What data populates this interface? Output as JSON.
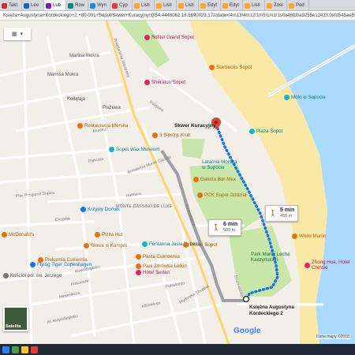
{
  "browser": {
    "tabs": [
      {
        "label": "Takt",
        "color": "#d32f2f"
      },
      {
        "label": "Leo",
        "color": "#1565c0"
      },
      {
        "label": "Lub",
        "color": "#7b1fa2"
      },
      {
        "label": "Row",
        "color": "#00897b"
      },
      {
        "label": "Wyn",
        "color": "#1e88e5"
      },
      {
        "label": "Cyp",
        "color": "#e53935"
      },
      {
        "label": "Listi",
        "color": "#f9a825"
      },
      {
        "label": "Listi",
        "color": "#f9a825"
      },
      {
        "label": "Listi",
        "color": "#f9a825"
      },
      {
        "label": "Edyt",
        "color": "#f9a825"
      },
      {
        "label": "Edyt",
        "color": "#f9a825"
      },
      {
        "label": "Listi",
        "color": "#f9a825"
      },
      {
        "label": "Zosi",
        "color": "#f9a825"
      },
      {
        "label": "Pod",
        "color": "#f9a825"
      }
    ],
    "active_tab": 2,
    "url": "Księża+Augustyna+Kordeckiego+2,+80-001+Sopot/Skwer+Kuracyjny/@54.4446062,18.5690029,17z/data=!4m13!4m12!1m5!1m1!1s0x46fd0a9255e12433:0xfd545ae55c5d"
  },
  "map": {
    "colors": {
      "water": "#aadaff",
      "beach": "#fae9a6",
      "park": "#c8e6a7",
      "route_dots": "#1a73e8",
      "route_gray": "#9aa0a6",
      "restaurant": "#e8710a",
      "attraction": "#12b5cb",
      "shopping": "#1a73e8",
      "hotel": "#e91e63",
      "poi_green": "#0f9d58"
    },
    "layer_button_icon": "map-layers-icon",
    "destination": {
      "label": "Skwer Kuracyjny"
    },
    "origin": {
      "label_line1": "Księżna Augustyna",
      "label_line2": "Kordeckiego 2"
    },
    "walk_box_1": {
      "time": "5 min",
      "distance": "450 m",
      "icon": "walking-person-icon"
    },
    "walk_box_2": {
      "time": "6 min",
      "distance": "500 m",
      "icon": "walking-person-icon"
    },
    "places": [
      {
        "text": "Sofitel Grand Sopot",
        "kind": "hotel"
      },
      {
        "text": "Sheraton Sopot",
        "kind": "hotel"
      },
      {
        "text": "Starbucks Sopot",
        "kind": "restaurant"
      },
      {
        "text": "Molo w Sopocie",
        "kind": "attraction"
      },
      {
        "text": "Restauracja Morska",
        "kind": "restaurant"
      },
      {
        "text": "3 Siostry. Klub",
        "kind": "restaurant"
      },
      {
        "text": "Plaża Sopot",
        "kind": "attraction"
      },
      {
        "text": "Sopot Wax Museum",
        "kind": "attraction"
      },
      {
        "text": "Latarnia Morska w Sopocie",
        "kind": "attraction"
      },
      {
        "text": "Krzywy Domek",
        "kind": "shopping"
      },
      {
        "text": "Galeria Bar-Mex",
        "kind": "restaurant"
      },
      {
        "text": "PCK Sopot Oddział",
        "kind": "restaurant"
      },
      {
        "text": "Pizza Hut",
        "kind": "restaurant"
      },
      {
        "text": "Piekarnia Cukiernia",
        "kind": "restaurant"
      },
      {
        "text": "Fontanna Jasia Rybaka",
        "kind": "attraction"
      },
      {
        "text": "Polski Sopot",
        "kind": "restaurant"
      },
      {
        "text": "Pasta Cukrownia",
        "kind": "restaurant"
      },
      {
        "text": "Pani Zdrówka Łelkin",
        "kind": "restaurant"
      },
      {
        "text": "Słowa w Kompot",
        "kind": "restaurant"
      },
      {
        "text": "Hotel Sedan",
        "kind": "hotel"
      },
      {
        "text": "Flying Tiger Copenhagen",
        "kind": "shopping"
      },
      {
        "text": "McDonald's",
        "kind": "restaurant"
      },
      {
        "text": "White Marlin",
        "kind": "restaurant"
      },
      {
        "text": "Park Marii i Lecha Kaczyńskich",
        "kind": "park"
      },
      {
        "text": "Zhong Hua, Hotel Chiński",
        "kind": "hotel"
      },
      {
        "text": "Kościół pw. św. Jerzego",
        "kind": "church"
      }
    ],
    "area_labels": [
      {
        "text": "MONTE CASSINO DE LUXE"
      },
      {
        "text": "Marlisa Mokra"
      },
      {
        "text": "Mamisa Mokra"
      },
      {
        "text": "Plażowa"
      },
      {
        "text": "Kołłątaja"
      }
    ],
    "street_labels": [
      {
        "text": "Powstańców Warszawy"
      },
      {
        "text": "Grunwaldzka"
      },
      {
        "text": "Bohaterów Monte Cassino"
      },
      {
        "text": "Chopina"
      },
      {
        "text": "Kolejowa"
      },
      {
        "text": "Morska"
      },
      {
        "text": "Parkowa"
      },
      {
        "text": "Haffnera"
      },
      {
        "text": "Niepodległości"
      },
      {
        "text": "Kościuszki"
      },
      {
        "text": "Mickiewicza"
      },
      {
        "text": "Pułaskiego"
      },
      {
        "text": "Fryderyka Chopina"
      },
      {
        "text": "Kilińskiego"
      },
      {
        "text": "Plac Przyjaciół Sopotu"
      },
      {
        "text": "Al. Niepodległości"
      },
      {
        "text": "Grunwaldzka"
      }
    ],
    "satellite_label": "Satelita",
    "google_logo": "Google",
    "attribution": "Dane mapy ©2018"
  }
}
